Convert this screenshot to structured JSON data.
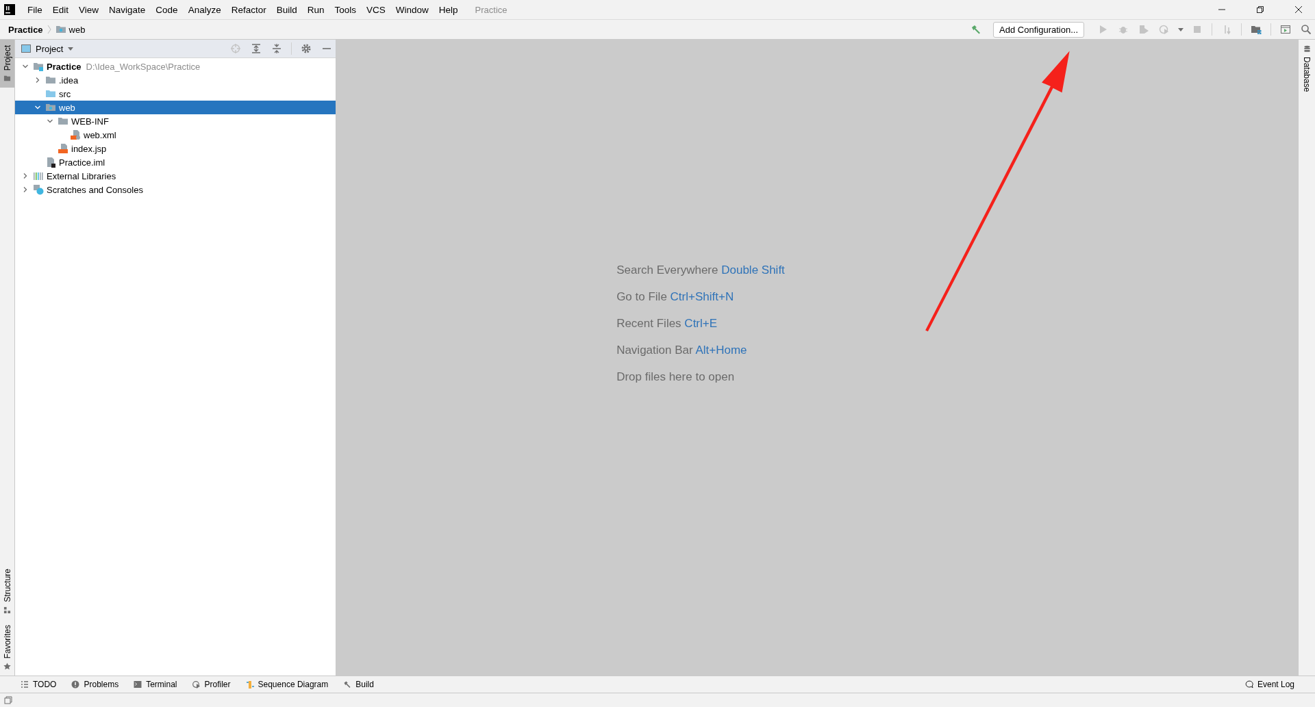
{
  "window": {
    "title": "Practice"
  },
  "menu": [
    "File",
    "Edit",
    "View",
    "Navigate",
    "Code",
    "Analyze",
    "Refactor",
    "Build",
    "Run",
    "Tools",
    "VCS",
    "Window",
    "Help"
  ],
  "breadcrumb": [
    {
      "label": "Practice",
      "kind": "project"
    },
    {
      "label": "web",
      "kind": "web-folder"
    }
  ],
  "toolbar": {
    "configuration": "Add Configuration..."
  },
  "left_stripe": [
    {
      "label": "Project",
      "selected": true,
      "kind": "folder"
    },
    {
      "label": "Structure",
      "selected": false,
      "kind": "structure"
    },
    {
      "label": "Favorites",
      "selected": false,
      "kind": "star"
    }
  ],
  "right_stripe": [
    {
      "label": "Database",
      "kind": "database"
    }
  ],
  "project_panel": {
    "title": "Project",
    "tree": [
      {
        "label": "Practice",
        "path": "D:\\Idea_WorkSpace\\Practice",
        "kind": "project",
        "expanded": true,
        "selected": false,
        "children": [
          {
            "label": ".idea",
            "kind": "folder",
            "expanded": false,
            "selected": false
          },
          {
            "label": "src",
            "kind": "source-folder",
            "selected": false
          },
          {
            "label": "web",
            "kind": "web-folder",
            "expanded": true,
            "selected": true,
            "children": [
              {
                "label": "WEB-INF",
                "kind": "folder",
                "expanded": true,
                "selected": false,
                "children": [
                  {
                    "label": "web.xml",
                    "kind": "xml",
                    "selected": false
                  }
                ]
              },
              {
                "label": "index.jsp",
                "kind": "jsp",
                "selected": false
              }
            ]
          },
          {
            "label": "Practice.iml",
            "kind": "iml",
            "selected": false
          }
        ]
      },
      {
        "label": "External Libraries",
        "kind": "libraries",
        "expanded": false,
        "selected": false
      },
      {
        "label": "Scratches and Consoles",
        "kind": "scratches",
        "expanded": false,
        "selected": false
      }
    ]
  },
  "editor_hints": [
    {
      "text": "Search Everywhere",
      "shortcut": "Double Shift"
    },
    {
      "text": "Go to File",
      "shortcut": "Ctrl+Shift+N"
    },
    {
      "text": "Recent Files",
      "shortcut": "Ctrl+E"
    },
    {
      "text": "Navigation Bar",
      "shortcut": "Alt+Home"
    },
    {
      "text": "Drop files here to open"
    }
  ],
  "bottom_tabs": [
    {
      "label": "TODO",
      "kind": "list"
    },
    {
      "label": "Problems",
      "kind": "problems"
    },
    {
      "label": "Terminal",
      "kind": "terminal"
    },
    {
      "label": "Profiler",
      "kind": "profiler"
    },
    {
      "label": "Sequence Diagram",
      "kind": "sequence"
    },
    {
      "label": "Build",
      "kind": "hammer"
    }
  ],
  "event_log": "Event Log"
}
